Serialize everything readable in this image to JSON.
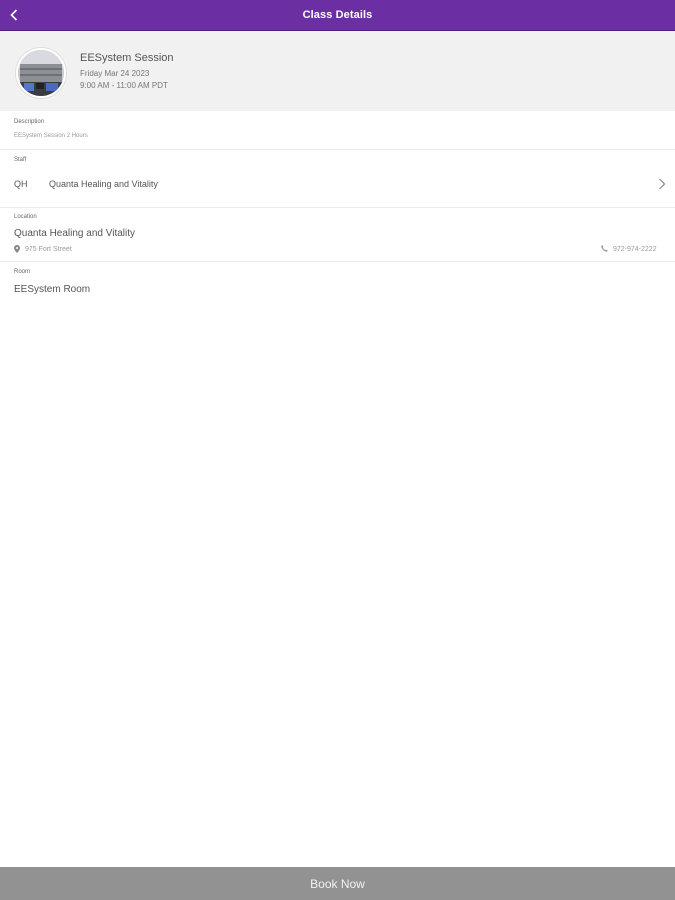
{
  "header_bar": {
    "title": "Class Details",
    "back_icon": "chevron-left-icon",
    "bg_color": "#6b2fa3"
  },
  "class_info": {
    "name": "EESystem Session",
    "date": "Friday Mar 24 2023",
    "time": "9:00 AM - 11:00 AM PDT"
  },
  "description": {
    "label": "Description",
    "text": "EESystem Session 2 Hours"
  },
  "staff": {
    "label": "Staff",
    "initials": "QH",
    "name": "Quanta Healing and Vitality",
    "chevron_icon": "chevron-right-icon"
  },
  "location": {
    "label": "Location",
    "name": "Quanta Healing and Vitality",
    "address": "975 Fort Street",
    "phone": "972-974-2222",
    "pin_icon": "map-pin-icon",
    "phone_icon": "phone-icon"
  },
  "room": {
    "label": "Room",
    "name": "EESystem Room"
  },
  "footer": {
    "book_now": "Book Now"
  }
}
